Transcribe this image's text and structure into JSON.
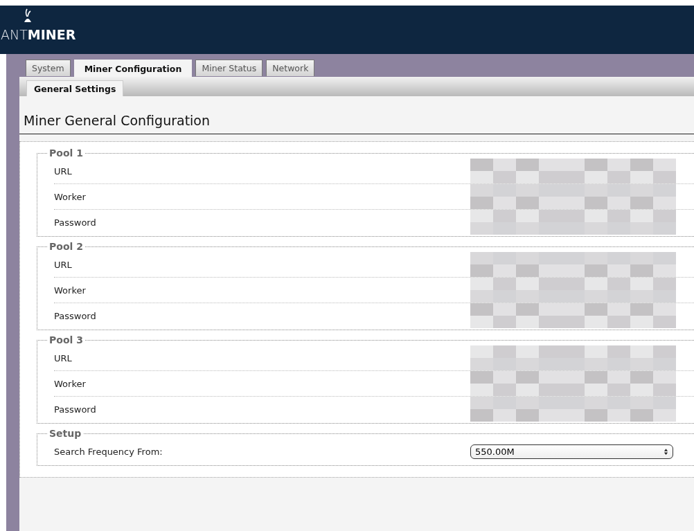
{
  "logo": {
    "prefix": "ANT",
    "name": "MINER"
  },
  "tabs": [
    {
      "label": "System",
      "selected": false
    },
    {
      "label": "Miner Configuration",
      "selected": true
    },
    {
      "label": "Miner Status",
      "selected": false
    },
    {
      "label": "Network",
      "selected": false
    }
  ],
  "subtabs": [
    {
      "label": "General Settings",
      "selected": true
    }
  ],
  "heading": "Miner General Configuration",
  "sections": [
    {
      "legend": "Pool 1",
      "rows": [
        {
          "label": "URL",
          "kind": "redacted"
        },
        {
          "label": "Worker",
          "kind": "redacted"
        },
        {
          "label": "Password",
          "kind": "redacted"
        }
      ]
    },
    {
      "legend": "Pool 2",
      "rows": [
        {
          "label": "URL",
          "kind": "redacted"
        },
        {
          "label": "Worker",
          "kind": "redacted"
        },
        {
          "label": "Password",
          "kind": "redacted"
        }
      ]
    },
    {
      "legend": "Pool 3",
      "rows": [
        {
          "label": "URL",
          "kind": "redacted"
        },
        {
          "label": "Worker",
          "kind": "redacted"
        },
        {
          "label": "Password",
          "kind": "redacted"
        }
      ]
    },
    {
      "legend": "Setup",
      "rows": [
        {
          "label": "Search Frequency From:",
          "kind": "select",
          "value": "550.00M"
        }
      ]
    }
  ]
}
